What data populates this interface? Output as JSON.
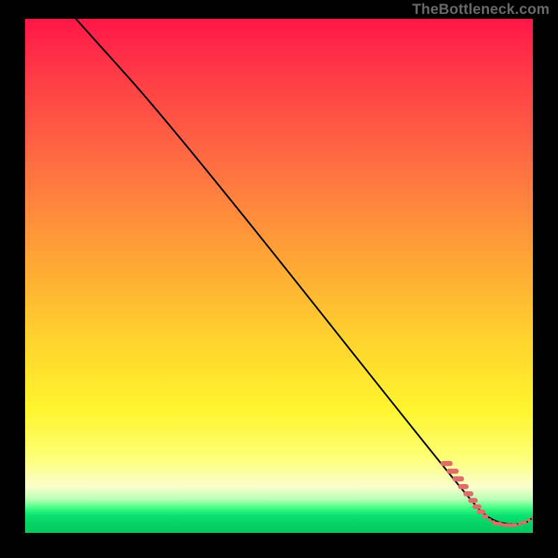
{
  "watermark": "TheBottleneck.com",
  "chart_data": {
    "type": "line",
    "title": "",
    "xlabel": "",
    "ylabel": "",
    "xlim": [
      0,
      100
    ],
    "ylim": [
      0,
      100
    ],
    "series": [
      {
        "name": "curve",
        "x": [
          10,
          30,
          87,
          92,
          98,
          100
        ],
        "y": [
          100,
          78,
          7,
          2,
          1.5,
          3
        ],
        "color": "#000000"
      }
    ],
    "markers": {
      "name": "dash-dots",
      "color": "#df6e6a",
      "points": [
        {
          "x": 83,
          "y": 13.5,
          "w": 2.4,
          "h": 1.0
        },
        {
          "x": 84.2,
          "y": 12.0,
          "w": 2.4,
          "h": 1.0
        },
        {
          "x": 85.3,
          "y": 10.5,
          "w": 2.3,
          "h": 1.0
        },
        {
          "x": 86.3,
          "y": 9.0,
          "w": 2.1,
          "h": 1.0
        },
        {
          "x": 87.3,
          "y": 7.6,
          "w": 2.0,
          "h": 1.0
        },
        {
          "x": 88.2,
          "y": 6.3,
          "w": 1.9,
          "h": 1.0
        },
        {
          "x": 89.0,
          "y": 5.1,
          "w": 1.8,
          "h": 0.9
        },
        {
          "x": 89.8,
          "y": 4.1,
          "w": 1.7,
          "h": 0.9
        },
        {
          "x": 90.6,
          "y": 3.2,
          "w": 1.3,
          "h": 0.8
        },
        {
          "x": 91.5,
          "y": 2.5,
          "w": 0.7,
          "h": 0.7
        },
        {
          "x": 92.3,
          "y": 2.1,
          "w": 0.7,
          "h": 0.7
        },
        {
          "x": 93.0,
          "y": 1.8,
          "w": 1.8,
          "h": 0.7
        },
        {
          "x": 94.0,
          "y": 1.6,
          "w": 0.7,
          "h": 0.7
        },
        {
          "x": 95.0,
          "y": 1.5,
          "w": 1.8,
          "h": 0.7
        },
        {
          "x": 96.3,
          "y": 1.5,
          "w": 1.4,
          "h": 0.7
        },
        {
          "x": 97.4,
          "y": 1.7,
          "w": 0.7,
          "h": 0.7
        },
        {
          "x": 98.2,
          "y": 2.0,
          "w": 1.2,
          "h": 0.7
        },
        {
          "x": 99.2,
          "y": 2.5,
          "w": 0.7,
          "h": 0.7
        },
        {
          "x": 100.0,
          "y": 3.0,
          "w": 0.7,
          "h": 0.7
        }
      ]
    },
    "gradient_stops": [
      {
        "pos": 0,
        "color": "#ff1648"
      },
      {
        "pos": 45,
        "color": "#ffa037"
      },
      {
        "pos": 76,
        "color": "#fff52e"
      },
      {
        "pos": 95,
        "color": "#4dff88"
      },
      {
        "pos": 100,
        "color": "#05c962"
      }
    ]
  }
}
